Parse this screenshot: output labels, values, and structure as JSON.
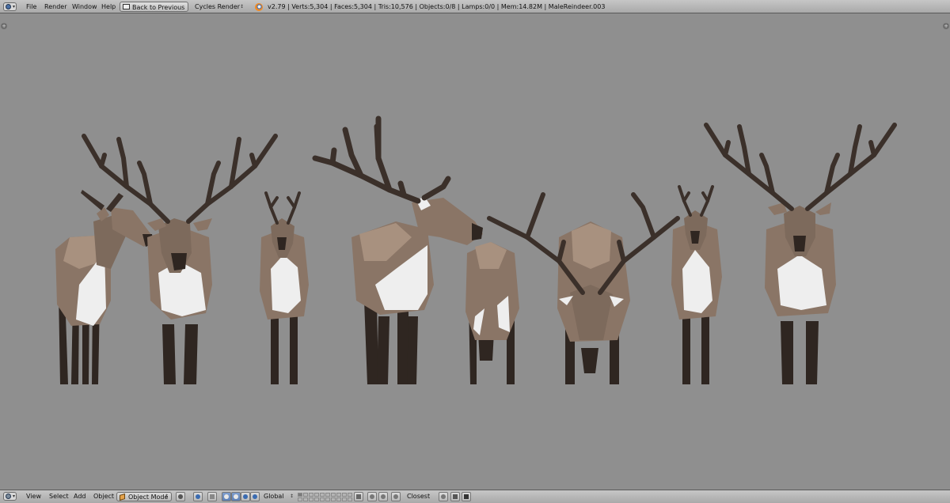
{
  "top_bar": {
    "menus": [
      "File",
      "Render",
      "Window",
      "Help"
    ],
    "back_button": "Back to Previous",
    "render_engine": "Cycles Render",
    "status": "v2.79 | Verts:5,304 | Faces:5,304 | Tris:10,576 | Objects:0/8 | Lamps:0/0 | Mem:14.82M | MaleReindeer.003"
  },
  "bottom_bar": {
    "menus": [
      "View",
      "Select",
      "Add",
      "Object"
    ],
    "mode": "Object Mode",
    "orientation": "Global",
    "snap": "Closest"
  },
  "colors": {
    "header": "#b8b8b8",
    "viewport": "#8f8f8f",
    "fur": "#8a7566",
    "fur_light": "#a8917f",
    "fur_dark": "#6e5b4e",
    "antler": "#3b302a",
    "leg": "#2f2621",
    "belly": "#eeeeee",
    "accent": "#5d7fb5"
  },
  "icons": [
    "editor-type-icon",
    "blender-logo-icon",
    "shading-sphere-icon",
    "pivot-icon",
    "manipulator-icon",
    "translate-icon",
    "rotate-icon",
    "scale-icon",
    "magnet-icon",
    "render-icon",
    "clapboard-icon"
  ]
}
